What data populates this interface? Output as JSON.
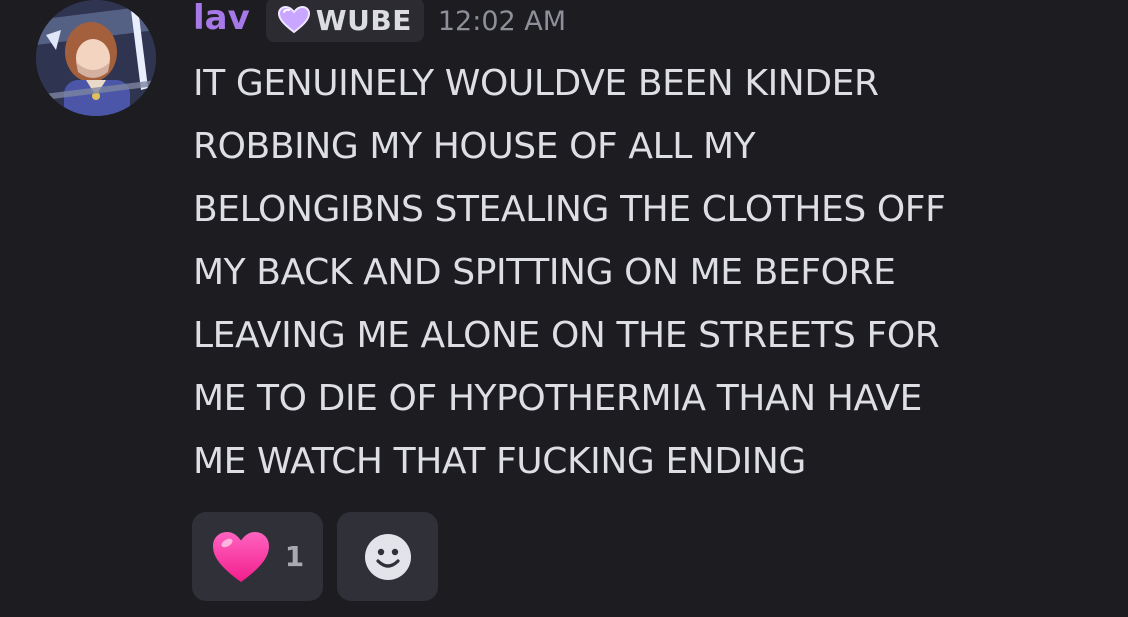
{
  "author": {
    "username": "lav",
    "role_tag": "WUBE",
    "role_icon": "purple-heart-icon",
    "timestamp": "12:02 AM",
    "username_color": "#a779e8"
  },
  "message": {
    "text": "IT GENUINELY WOULDVE BEEN KINDER\nROBBING MY HOUSE OF ALL MY\nBELONGIBNS STEALING THE CLOTHES OFF\nMY BACK AND SPITTING ON ME BEFORE\nLEAVING ME ALONE ON THE STREETS FOR\nME TO DIE OF HYPOTHERMIA THAN HAVE\nME WATCH THAT FUCKING ENDING"
  },
  "reactions": [
    {
      "emoji": "pink-heart-icon",
      "count": "1"
    },
    {
      "emoji": "add-reaction-smiley-icon",
      "count": ""
    }
  ],
  "colors": {
    "background": "#1c1c21",
    "text": "#dedfe4",
    "reaction_bg": "#303038",
    "heart": "#ff3fa4"
  }
}
